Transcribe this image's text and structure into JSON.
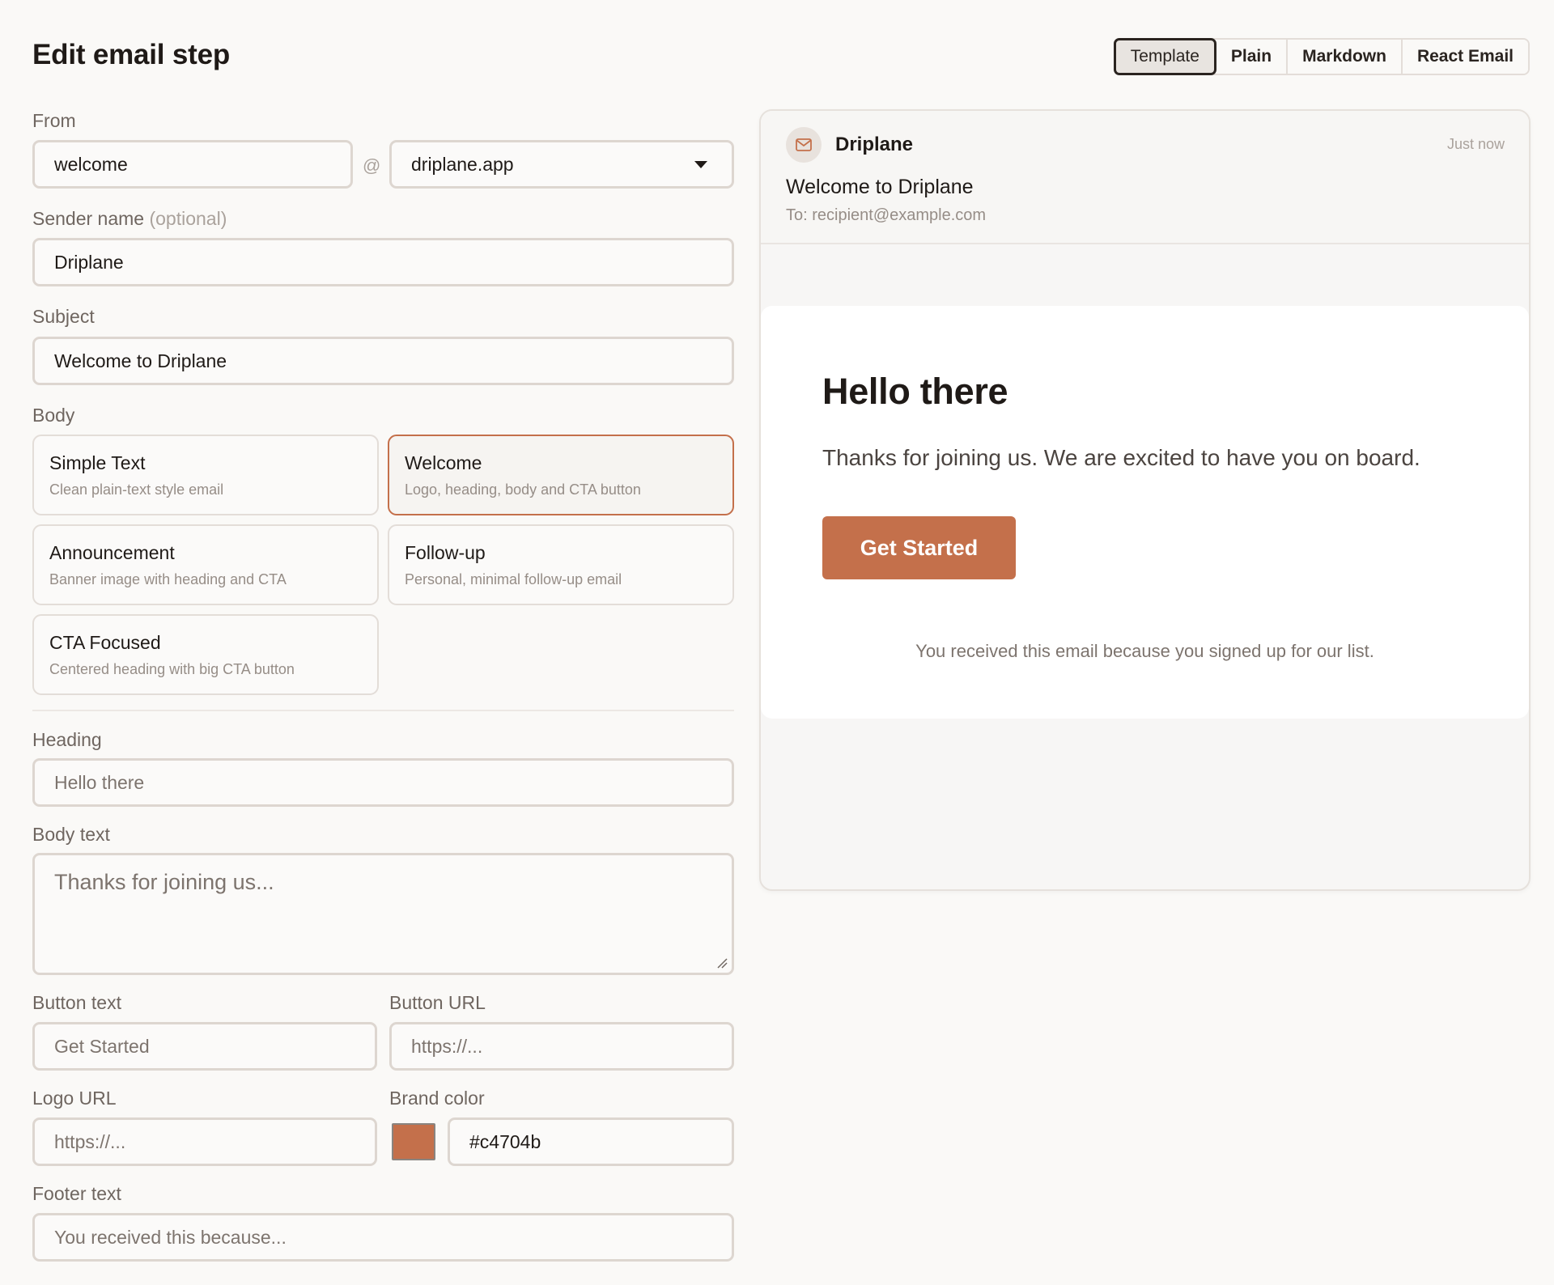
{
  "page": {
    "title": "Edit email step"
  },
  "tabs": [
    {
      "label": "Template",
      "active": true
    },
    {
      "label": "Plain"
    },
    {
      "label": "Markdown"
    },
    {
      "label": "React Email"
    }
  ],
  "form": {
    "from_label": "From",
    "from_local": "welcome",
    "at_sign": "@",
    "from_domain": "driplane.app",
    "sender_label": "Sender name",
    "sender_optional": "(optional)",
    "sender_value": "Driplane",
    "subject_label": "Subject",
    "subject_value": "Welcome to Driplane",
    "body_label": "Body",
    "templates": [
      {
        "title": "Simple Text",
        "desc": "Clean plain-text style email"
      },
      {
        "title": "Welcome",
        "desc": "Logo, heading, body and CTA button",
        "selected": true
      },
      {
        "title": "Announcement",
        "desc": "Banner image with heading and CTA"
      },
      {
        "title": "Follow-up",
        "desc": "Personal, minimal follow-up email"
      },
      {
        "title": "CTA Focused",
        "desc": "Centered heading with big CTA button"
      }
    ],
    "heading_label": "Heading",
    "heading_placeholder": "Hello there",
    "bodytext_label": "Body text",
    "bodytext_placeholder": "Thanks for joining us...",
    "button_text_label": "Button text",
    "button_text_placeholder": "Get Started",
    "button_url_label": "Button URL",
    "button_url_placeholder": "https://...",
    "logo_url_label": "Logo URL",
    "logo_url_placeholder": "https://...",
    "brand_color_label": "Brand color",
    "brand_color_value": "#c4704b",
    "footer_label": "Footer text",
    "footer_placeholder": "You received this because..."
  },
  "preview": {
    "sender": "Driplane",
    "time": "Just now",
    "subject": "Welcome to Driplane",
    "to": "To: recipient@example.com",
    "email_heading": "Hello there",
    "email_text": "Thanks for joining us. We are excited to have you on board.",
    "email_button": "Get Started",
    "email_footer": "You received this email because you signed up for our list."
  },
  "colors": {
    "brand": "#c4704b",
    "background": "#faf9f7",
    "border": "#ddd6d0"
  },
  "icons": {
    "avatar": "mail-icon",
    "dropdown": "chevron-down-icon"
  }
}
